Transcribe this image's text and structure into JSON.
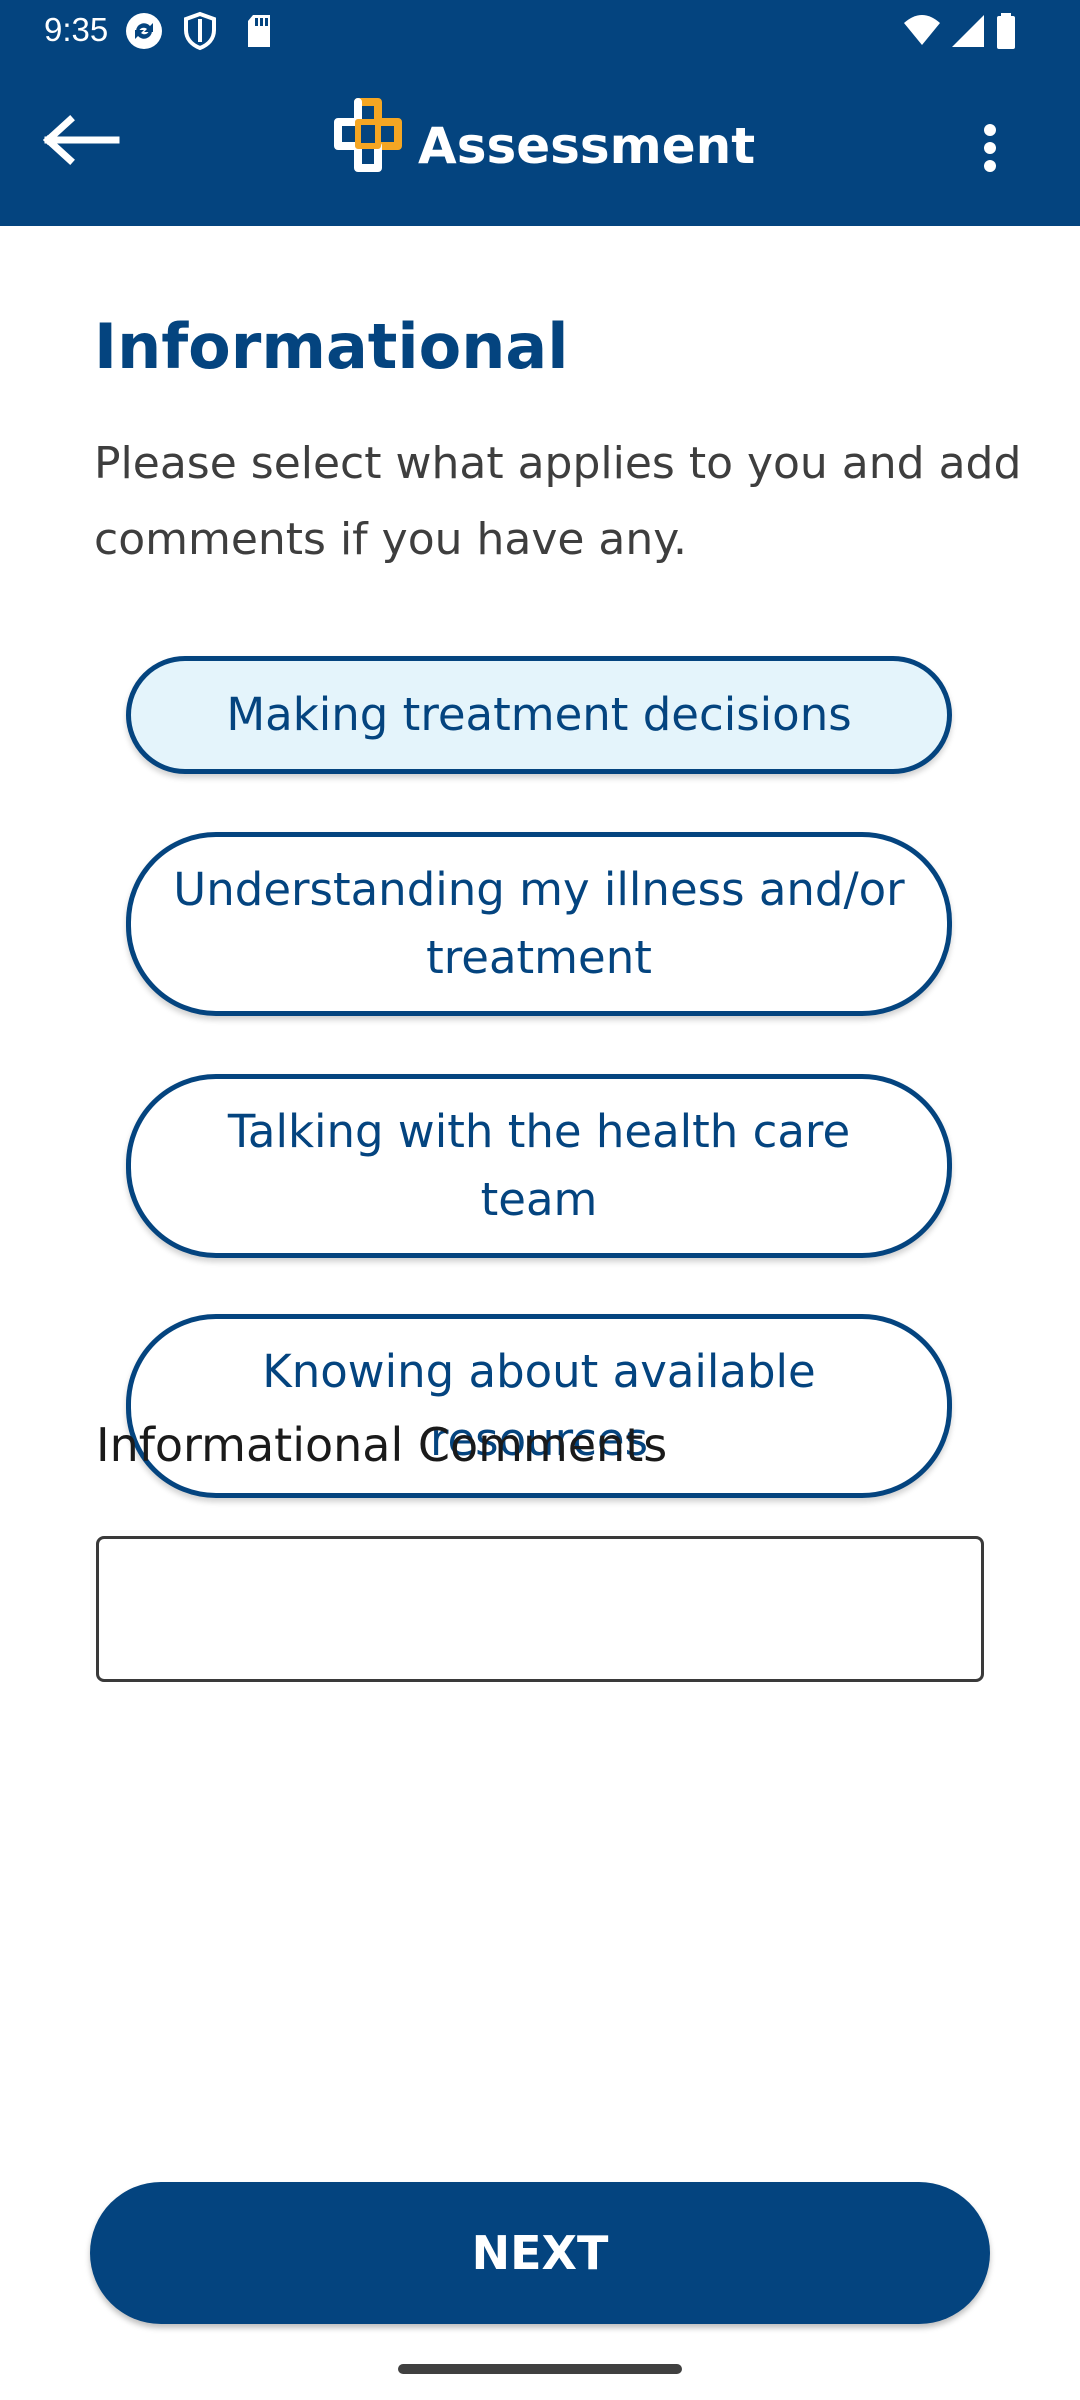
{
  "status_bar": {
    "time": "9:35",
    "left_icons": [
      "sync-icon",
      "shield-icon",
      "sd-card-icon"
    ],
    "right_icons": [
      "wifi-icon",
      "signal-icon",
      "battery-icon"
    ]
  },
  "app_bar": {
    "title": "Assessment",
    "back_icon": "arrow-left-icon",
    "logo_icon": "medical-cross-logo",
    "menu_icon": "more-vertical-icon"
  },
  "main": {
    "section_title": "Informational",
    "instructions": "Please select what applies to you and add comments if you have any.",
    "options": [
      {
        "label": "Making treatment decisions",
        "selected": true
      },
      {
        "label": "Understanding my illness and/or treatment",
        "selected": false
      },
      {
        "label": "Talking with the health care team",
        "selected": false
      },
      {
        "label": "Knowing about available resources",
        "selected": false
      }
    ],
    "comments_label": "Informational Comments",
    "comments_value": "",
    "next_label": "NEXT"
  },
  "colors": {
    "primary": "#04447f",
    "accent_logo": "#f5a623",
    "selected_fill": "#e4f4fb",
    "text": "#3e3e3e"
  }
}
